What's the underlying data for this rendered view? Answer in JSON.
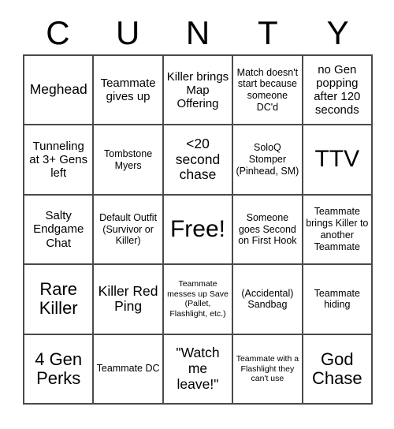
{
  "card": {
    "header_letters": [
      "C",
      "U",
      "N",
      "T",
      "Y"
    ],
    "columns": 5,
    "rows": 5,
    "border_color": "#4a4a4a",
    "background_color": "#ffffff",
    "text_color": "#000000",
    "free_space": {
      "row": 3,
      "column": 3,
      "label": "Free!"
    },
    "cells": [
      {
        "text": "Meghead",
        "size": "lg"
      },
      {
        "text": "Teammate gives up",
        "size": "md"
      },
      {
        "text": "Killer brings Map Offering",
        "size": "md"
      },
      {
        "text": "Match doesn't start because someone DC'd",
        "size": "sm"
      },
      {
        "text": "no Gen popping after 120 seconds",
        "size": "md"
      },
      {
        "text": "Tunneling at 3+ Gens left",
        "size": "md"
      },
      {
        "text": "Tombstone Myers",
        "size": "sm"
      },
      {
        "text": "<20 second chase",
        "size": "lg"
      },
      {
        "text": "SoloQ Stomper (Pinhead, SM)",
        "size": "sm"
      },
      {
        "text": "TTV",
        "size": "xxl"
      },
      {
        "text": "Salty Endgame Chat",
        "size": "md"
      },
      {
        "text": "Default Outfit (Survivor or Killer)",
        "size": "sm"
      },
      {
        "text": "Free!",
        "size": "xxl"
      },
      {
        "text": "Someone goes Second on First Hook",
        "size": "sm"
      },
      {
        "text": "Teammate brings Killer to another Teammate",
        "size": "sm"
      },
      {
        "text": "Rare Killer",
        "size": "xl"
      },
      {
        "text": "Killer Red Ping",
        "size": "lg"
      },
      {
        "text": "Teammate messes up Save (Pallet, Flashlight, etc.)",
        "size": "xs"
      },
      {
        "text": "(Accidental) Sandbag",
        "size": "sm"
      },
      {
        "text": "Teammate hiding",
        "size": "sm"
      },
      {
        "text": "4 Gen Perks",
        "size": "xl"
      },
      {
        "text": "Teammate DC",
        "size": "sm"
      },
      {
        "text": "\"Watch me leave!\"",
        "size": "lg"
      },
      {
        "text": "Teammate with a Flashlight they can't use",
        "size": "xs"
      },
      {
        "text": "God Chase",
        "size": "xl"
      }
    ]
  }
}
